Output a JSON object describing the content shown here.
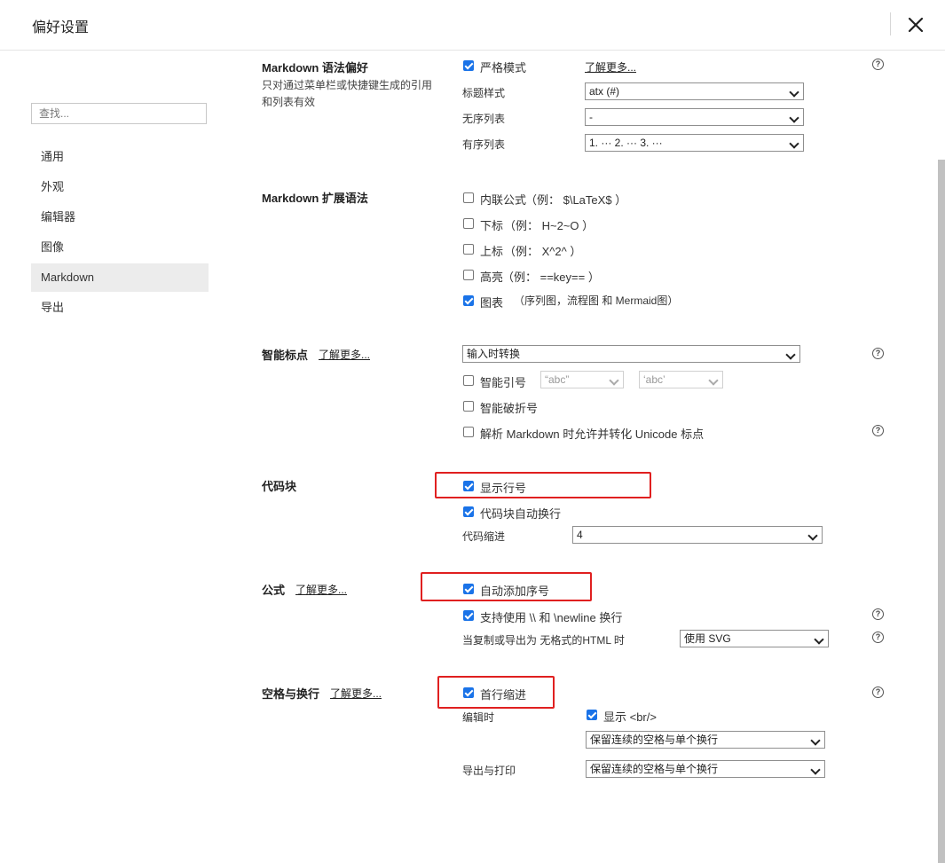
{
  "window": {
    "title": "偏好设置"
  },
  "sidebar": {
    "search_placeholder": "查找...",
    "items": [
      {
        "label": "通用"
      },
      {
        "label": "外观"
      },
      {
        "label": "编辑器"
      },
      {
        "label": "图像"
      },
      {
        "label": "Markdown",
        "active": true
      },
      {
        "label": "导出"
      }
    ]
  },
  "markdown_syntax": {
    "title": "Markdown 语法偏好",
    "desc_line1": "只对通过菜单栏或快捷键生成的引用",
    "desc_line2": "和列表有效",
    "strict_mode": {
      "label": "严格模式",
      "checked": true
    },
    "learn_more": "了解更多...",
    "heading_style": {
      "label": "标题样式",
      "value": "atx (#)"
    },
    "unordered_list": {
      "label": "无序列表",
      "value": "-"
    },
    "ordered_list": {
      "label": "有序列表",
      "value": "1. ··· 2. ··· 3. ···"
    }
  },
  "extended_syntax": {
    "title": "Markdown 扩展语法",
    "inline_math": {
      "label": "内联公式",
      "example": "（例：  $\\LaTeX$ ）",
      "checked": false
    },
    "subscript": {
      "label": "下标",
      "example": "（例：  H~2~O ）",
      "checked": false
    },
    "superscript": {
      "label": "上标",
      "example": "（例：  X^2^ ）",
      "checked": false
    },
    "highlight": {
      "label": "高亮",
      "example": "（例：  ==key== ）",
      "checked": false
    },
    "diagrams": {
      "label": "图表",
      "example": "（序列图，流程图 和 Mermaid图）",
      "checked": true
    }
  },
  "smart_punctuation": {
    "title": "智能标点",
    "learn_more": "了解更多...",
    "mode": {
      "value": "输入时转换"
    },
    "smart_quotes": {
      "label": "智能引号",
      "checked": false,
      "double_quote": "“abc”",
      "single_quote": "‘abc’"
    },
    "smart_dashes": {
      "label": "智能破折号",
      "checked": false
    },
    "unicode_punct": {
      "label": "解析 Markdown 时允许并转化 Unicode 标点",
      "checked": false
    }
  },
  "code_block": {
    "title": "代码块",
    "show_line_numbers": {
      "label": "显示行号",
      "checked": true
    },
    "auto_wrap": {
      "label": "代码块自动换行",
      "checked": true
    },
    "indent": {
      "label": "代码缩进",
      "value": "4"
    }
  },
  "math": {
    "title": "公式",
    "learn_more": "了解更多...",
    "auto_number": {
      "label": "自动添加序号",
      "checked": true
    },
    "newline_support": {
      "label": "支持使用 \\\\ 和 \\newline 换行",
      "checked": true
    },
    "export_plain": {
      "label": "当复制或导出为 无格式的HTML 时",
      "value": "使用 SVG"
    }
  },
  "whitespace": {
    "title": "空格与换行",
    "learn_more": "了解更多...",
    "first_line_indent": {
      "label": "首行缩进",
      "checked": true
    },
    "editing": {
      "label": "编辑时",
      "show_br": {
        "label": "显示 <br/>",
        "checked": true
      },
      "value": "保留连续的空格与单个换行"
    },
    "export_print": {
      "label": "导出与打印",
      "value": "保留连续的空格与单个换行"
    }
  },
  "help_glyph": "?",
  "colors": {
    "accent": "#1a73e8",
    "highlight_box": "#e02020",
    "active_nav": "#ececec"
  }
}
